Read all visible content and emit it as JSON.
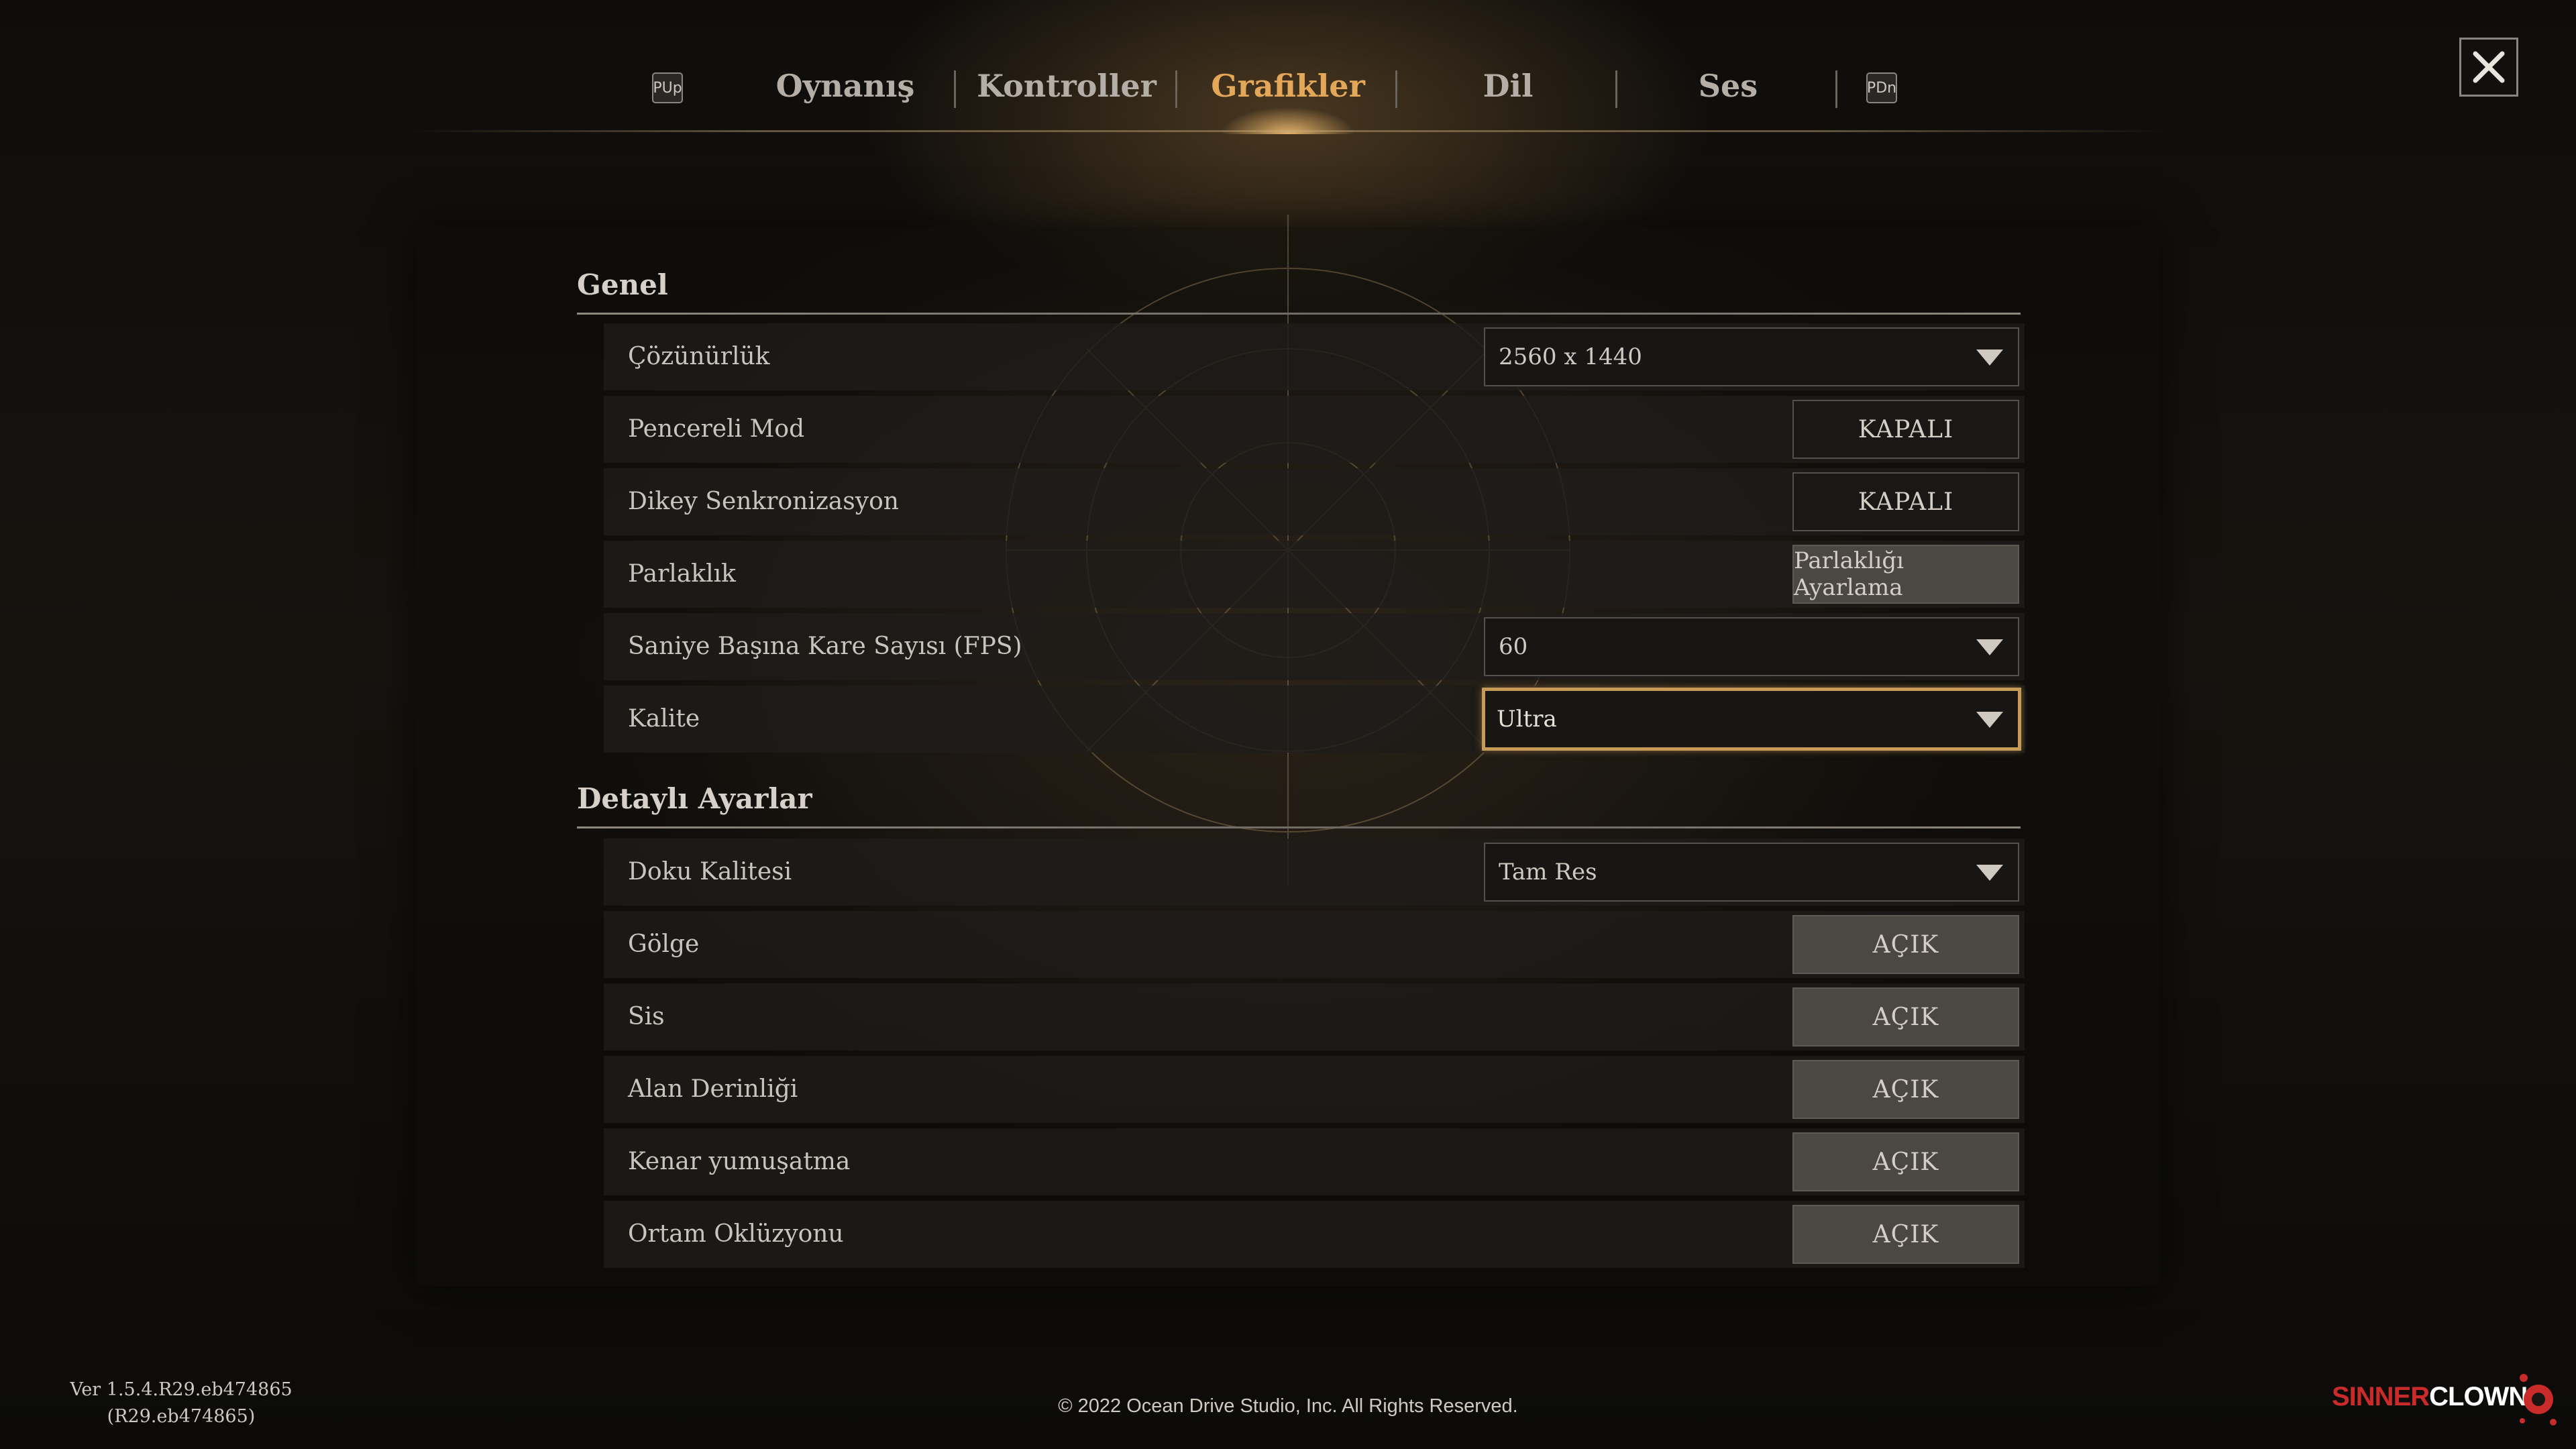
{
  "tabs": {
    "left_key": "PUp",
    "right_key": "PDn",
    "items": [
      {
        "label": "Oynanış"
      },
      {
        "label": "Kontroller"
      },
      {
        "label": "Grafikler"
      },
      {
        "label": "Dil"
      },
      {
        "label": "Ses"
      }
    ],
    "active": "Grafikler"
  },
  "close_icon": "close-icon",
  "sections": {
    "general": {
      "title": "Genel",
      "rows": [
        {
          "label": "Çözünürlük",
          "value": "2560 x 1440"
        },
        {
          "label": "Pencereli Mod",
          "value": "KAPALI"
        },
        {
          "label": "Dikey Senkronizasyon",
          "value": "KAPALI"
        },
        {
          "label": "Parlaklık",
          "value": "Parlaklığı Ayarlama"
        },
        {
          "label": "Saniye Başına Kare Sayısı (FPS)",
          "value": "60"
        },
        {
          "label": "Kalite",
          "value": "Ultra"
        }
      ]
    },
    "detailed": {
      "title": "Detaylı Ayarlar",
      "rows": [
        {
          "label": "Doku Kalitesi",
          "value": "Tam Res"
        },
        {
          "label": "Gölge",
          "value": "AÇIK"
        },
        {
          "label": "Sis",
          "value": "AÇIK"
        },
        {
          "label": "Alan Derinliği",
          "value": "AÇIK"
        },
        {
          "label": "Kenar yumuşatma",
          "value": "AÇIK"
        },
        {
          "label": "Ortam Oklüzyonu",
          "value": "AÇIK"
        }
      ]
    }
  },
  "footer": {
    "version_line1": "Ver 1.5.4.R29.eb474865",
    "version_line2": "(R29.eb474865)",
    "copyright": "© 2022 Ocean Drive Studio, Inc. All Rights Reserved.",
    "logo_part1": "SINNER",
    "logo_part2": "CLOWN"
  },
  "colors": {
    "active_tab": "#e3a759",
    "focus_border": "#c79a55",
    "toggle_on_bg": "#4b4743",
    "logo_red": "#c92a2a"
  }
}
